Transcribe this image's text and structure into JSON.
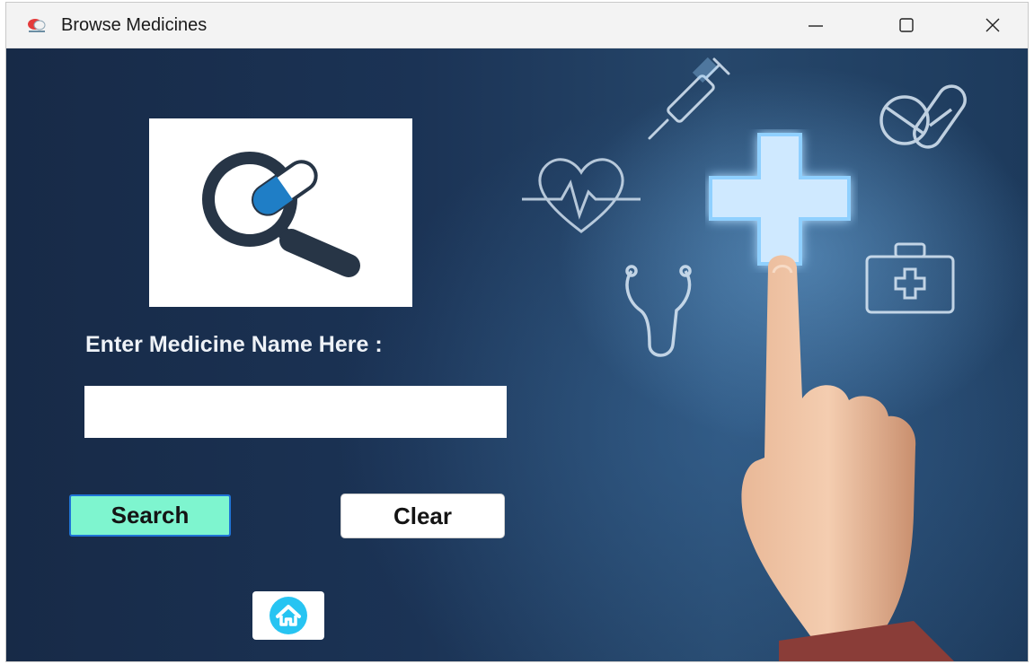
{
  "window": {
    "title": "Browse Medicines",
    "app_icon": "pharmacy-app-icon",
    "controls": [
      "minimize-icon",
      "maximize-icon",
      "close-icon"
    ]
  },
  "form": {
    "logo_icon": "medicine-search-icon",
    "prompt_label": "Enter Medicine Name Here :",
    "name_input": {
      "value": "",
      "placeholder": ""
    },
    "search_label": "Search",
    "clear_label": "Clear",
    "home_icon": "home-icon"
  },
  "background": {
    "icons": [
      "syringe-icon",
      "pills-icon",
      "heartbeat-icon",
      "medical-cross-icon",
      "stethoscope-icon",
      "first-aid-kit-icon",
      "pointing-hand"
    ]
  },
  "colors": {
    "search_button": "#7ef5cf",
    "search_border": "#1f74d6",
    "home_button": "#27c4f2",
    "background": "#1b3150"
  }
}
